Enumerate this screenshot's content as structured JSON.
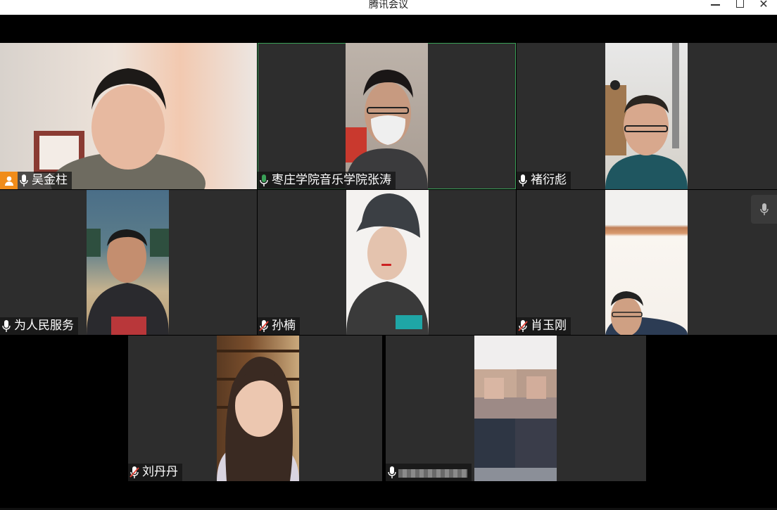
{
  "window": {
    "title": "腾讯会议"
  },
  "participants": [
    {
      "name": "吴金柱",
      "host": true,
      "mic": "on"
    },
    {
      "name": "枣庄学院音乐学院张涛",
      "mic": "speaking",
      "active": true
    },
    {
      "name": "褚衍彪",
      "mic": "on"
    },
    {
      "name": "为人民服务",
      "mic": "on"
    },
    {
      "name": "孙楠",
      "mic": "muted"
    },
    {
      "name": "肖玉刚",
      "mic": "muted"
    },
    {
      "name": "刘丹丹",
      "mic": "muted"
    },
    {
      "name": "",
      "mic": "on",
      "name_obscured": true
    }
  ],
  "icons": {
    "host": "host-person-icon",
    "mic_on": "microphone-icon",
    "mic_speaking": "microphone-active-icon",
    "mic_muted": "microphone-muted-icon",
    "side_panel": "microphone-icon"
  },
  "colors": {
    "host_badge": "#f08c1a",
    "speaking_green": "#3aa057",
    "tile_bg": "#2d2d2d",
    "muted_red": "#e0463a"
  }
}
